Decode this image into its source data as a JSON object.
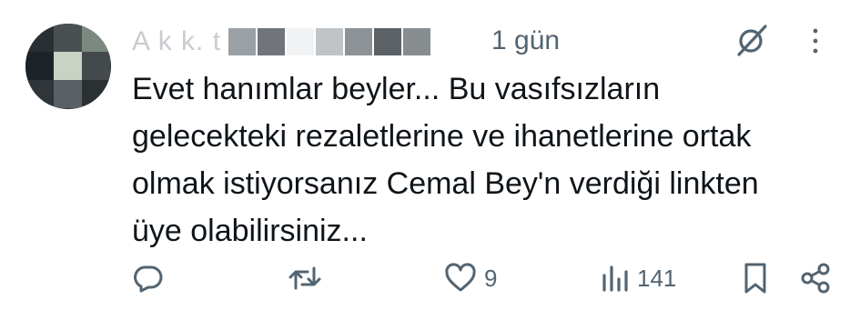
{
  "post": {
    "author_name": "A  k k. t",
    "timestamp": "1 gün",
    "text_lines": [
      "Evet hanımlar beyler... Bu vasıfsızların",
      "gelecekteki rezaletlerine ve ihanetlerine ortak",
      "olmak istiyorsanız Cemal Bey'n verdiği linkten",
      "üye olabilirsiniz..."
    ]
  },
  "actions": {
    "reply": {
      "icon": "reply-icon",
      "count": ""
    },
    "repost": {
      "icon": "repost-icon",
      "count": ""
    },
    "like": {
      "icon": "heart-icon",
      "count": "9"
    },
    "views": {
      "icon": "views-icon",
      "count": "141"
    },
    "bookmark": {
      "icon": "bookmark-icon"
    },
    "share": {
      "icon": "share-icon"
    }
  },
  "icons": {
    "grok": "grok-icon",
    "more": "more-vertical-icon"
  },
  "colors": {
    "text": "#0f1419",
    "secondary": "#536471",
    "background": "#ffffff"
  }
}
